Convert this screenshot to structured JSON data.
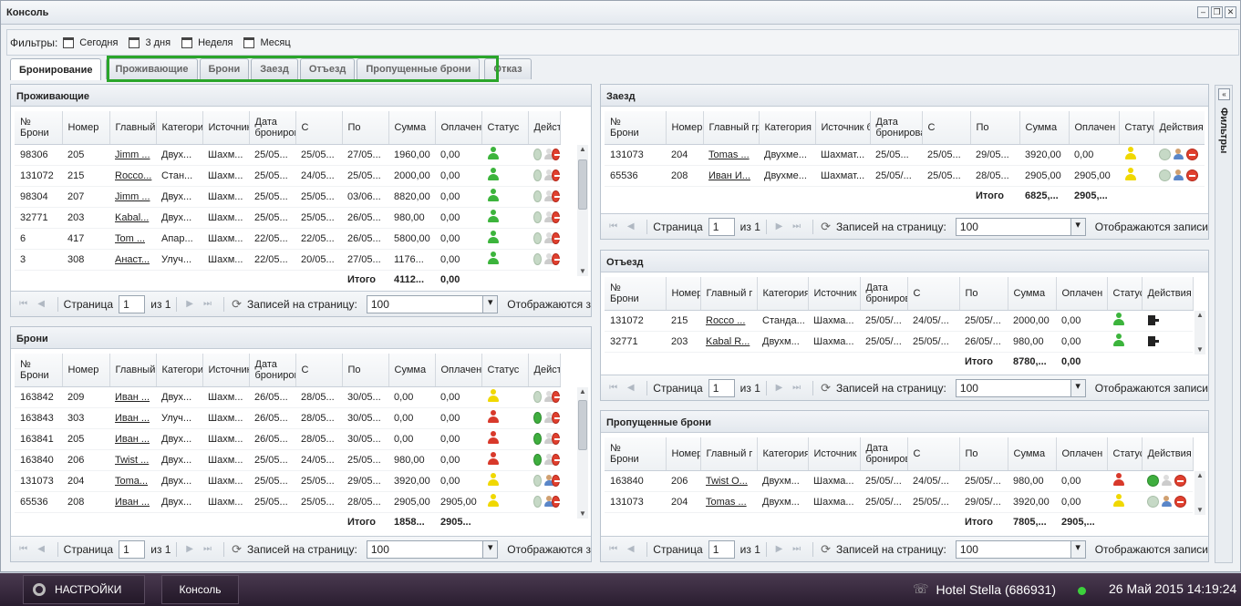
{
  "window": {
    "title": "Консоль"
  },
  "filters": {
    "label": "Фильтры:",
    "items": [
      "Сегодня",
      "3 дня",
      "Неделя",
      "Месяц"
    ]
  },
  "tabs": [
    "Бронирование",
    "Проживающие",
    "Брони",
    "Заезд",
    "Отъезд",
    "Пропущенные брони",
    "Отказ"
  ],
  "pager": {
    "page_label": "Страница",
    "page_value": "1",
    "of_label": "из 1",
    "per_page_label": "Записей на страницу:",
    "per_page_value": "100",
    "showing_label": "Отображаются записи",
    "showing_label_short": "Отображаются з",
    "total_label": "Итого"
  },
  "panels": {
    "residents": {
      "title": "Проживающие",
      "headers": [
        "№\nБрони",
        "Номер",
        "Главный",
        "Категори",
        "Источник",
        "Дата\nброниров",
        "С",
        "По",
        "Сумма",
        "Оплачен",
        "Статус",
        "Действия"
      ],
      "rows": [
        {
          "id": "98306",
          "room": "205",
          "guest": "Jimm ...",
          "cat": "Двух...",
          "src": "Шахм...",
          "date": "25/05...",
          "from": "25/05...",
          "to": "27/05...",
          "sum": "1960,00",
          "paid": "0,00",
          "status": "green",
          "actions": [
            "okg",
            "usrg",
            "no"
          ]
        },
        {
          "id": "131072",
          "room": "215",
          "guest": "Rocco...",
          "cat": "Стан...",
          "src": "Шахм...",
          "date": "25/05...",
          "from": "24/05...",
          "to": "25/05...",
          "sum": "2000,00",
          "paid": "0,00",
          "status": "green",
          "actions": [
            "okg",
            "usrg",
            "no"
          ]
        },
        {
          "id": "98304",
          "room": "207",
          "guest": "Jimm ...",
          "cat": "Двух...",
          "src": "Шахм...",
          "date": "25/05...",
          "from": "25/05...",
          "to": "03/06...",
          "sum": "8820,00",
          "paid": "0,00",
          "status": "green",
          "actions": [
            "okg",
            "usrg",
            "no"
          ]
        },
        {
          "id": "32771",
          "room": "203",
          "guest": "Kabal...",
          "cat": "Двух...",
          "src": "Шахм...",
          "date": "25/05...",
          "from": "25/05...",
          "to": "26/05...",
          "sum": "980,00",
          "paid": "0,00",
          "status": "green",
          "actions": [
            "okg",
            "usrg",
            "no"
          ]
        },
        {
          "id": "6",
          "room": "417",
          "guest": "Tom ...",
          "cat": "Апар...",
          "src": "Шахм...",
          "date": "22/05...",
          "from": "22/05...",
          "to": "26/05...",
          "sum": "5800,00",
          "paid": "0,00",
          "status": "green",
          "actions": [
            "okg",
            "usrg",
            "no"
          ]
        },
        {
          "id": "3",
          "room": "308",
          "guest": "Анаст...",
          "cat": "Улуч...",
          "src": "Шахм...",
          "date": "22/05...",
          "from": "20/05...",
          "to": "27/05...",
          "sum": "1176...",
          "paid": "0,00",
          "status": "green",
          "actions": [
            "okg",
            "usrg",
            "no"
          ]
        }
      ],
      "total_sum": "4112...",
      "total_paid": "0,00"
    },
    "bookings": {
      "title": "Брони",
      "headers": [
        "№\nБрони",
        "Номер",
        "Главный",
        "Категори",
        "Источник",
        "Дата\nброниров",
        "С",
        "По",
        "Сумма",
        "Оплачен",
        "Статус",
        "Действи"
      ],
      "rows": [
        {
          "id": "163842",
          "room": "209",
          "guest": "Иван ...",
          "cat": "Двух...",
          "src": "Шахм...",
          "date": "26/05...",
          "from": "28/05...",
          "to": "30/05...",
          "sum": "0,00",
          "paid": "0,00",
          "status": "yellow",
          "actions": [
            "okg",
            "usrg",
            "no"
          ]
        },
        {
          "id": "163843",
          "room": "303",
          "guest": "Иван ...",
          "cat": "Улуч...",
          "src": "Шахм...",
          "date": "26/05...",
          "from": "28/05...",
          "to": "30/05...",
          "sum": "0,00",
          "paid": "0,00",
          "status": "red",
          "actions": [
            "ok",
            "usrg",
            "no"
          ]
        },
        {
          "id": "163841",
          "room": "205",
          "guest": "Иван ...",
          "cat": "Двух...",
          "src": "Шахм...",
          "date": "26/05...",
          "from": "28/05...",
          "to": "30/05...",
          "sum": "0,00",
          "paid": "0,00",
          "status": "red",
          "actions": [
            "ok",
            "usrg",
            "no"
          ]
        },
        {
          "id": "163840",
          "room": "206",
          "guest": "Twist ...",
          "cat": "Двух...",
          "src": "Шахм...",
          "date": "25/05...",
          "from": "24/05...",
          "to": "25/05...",
          "sum": "980,00",
          "paid": "0,00",
          "status": "red",
          "actions": [
            "ok",
            "usrg",
            "no"
          ]
        },
        {
          "id": "131073",
          "room": "204",
          "guest": "Toma...",
          "cat": "Двух...",
          "src": "Шахм...",
          "date": "25/05...",
          "from": "25/05...",
          "to": "29/05...",
          "sum": "3920,00",
          "paid": "0,00",
          "status": "yellow",
          "actions": [
            "okg",
            "usr",
            "no"
          ]
        },
        {
          "id": "65536",
          "room": "208",
          "guest": "Иван ...",
          "cat": "Двух...",
          "src": "Шахм...",
          "date": "25/05...",
          "from": "25/05...",
          "to": "28/05...",
          "sum": "2905,00",
          "paid": "2905,00",
          "status": "yellow",
          "actions": [
            "okg",
            "usr",
            "no"
          ]
        }
      ],
      "total_sum": "1858...",
      "total_paid": "2905..."
    },
    "checkin": {
      "title": "Заезд",
      "headers": [
        "№\nБрони",
        "Номер",
        "Главный гр",
        "Категория",
        "Источник б",
        "Дата\nбронирова",
        "С",
        "По",
        "Сумма",
        "Оплачен",
        "Статус",
        "Действия"
      ],
      "rows": [
        {
          "id": "131073",
          "room": "204",
          "guest": "Tomas ...",
          "cat": "Двухме...",
          "src": "Шахмат...",
          "date": "25/05...",
          "from": "25/05...",
          "to": "29/05...",
          "sum": "3920,00",
          "paid": "0,00",
          "status": "yellow",
          "actions": [
            "okg",
            "usr",
            "no"
          ]
        },
        {
          "id": "65536",
          "room": "208",
          "guest": "Иван И...",
          "cat": "Двухме...",
          "src": "Шахмат...",
          "date": "25/05/...",
          "from": "25/05...",
          "to": "28/05...",
          "sum": "2905,00",
          "paid": "2905,00",
          "status": "yellow",
          "actions": [
            "okg",
            "usr",
            "no"
          ]
        }
      ],
      "total_sum": "6825,...",
      "total_paid": "2905,..."
    },
    "checkout": {
      "title": "Отъезд",
      "headers": [
        "№\nБрони",
        "Номер",
        "Главный г",
        "Категория",
        "Источник (",
        "Дата\nброниров",
        "С",
        "По",
        "Сумма",
        "Оплачен",
        "Статус",
        "Действия"
      ],
      "rows": [
        {
          "id": "131072",
          "room": "215",
          "guest": "Rocco ...",
          "cat": "Станда...",
          "src": "Шахма...",
          "date": "25/05/...",
          "from": "24/05/...",
          "to": "25/05/...",
          "sum": "2000,00",
          "paid": "0,00",
          "status": "green",
          "actions": [
            "exit"
          ]
        },
        {
          "id": "32771",
          "room": "203",
          "guest": "Kabal R...",
          "cat": "Двухм...",
          "src": "Шахма...",
          "date": "25/05/...",
          "from": "25/05/...",
          "to": "26/05/...",
          "sum": "980,00",
          "paid": "0,00",
          "status": "green",
          "actions": [
            "exit"
          ]
        }
      ],
      "total_sum": "8780,...",
      "total_paid": "0,00"
    },
    "missed": {
      "title": "Пропущенные брони",
      "headers": [
        "№\nБрони",
        "Номер",
        "Главный г",
        "Категория",
        "Источник (",
        "Дата\nброниров",
        "С",
        "По",
        "Сумма",
        "Оплачен",
        "Статус",
        "Действия"
      ],
      "rows": [
        {
          "id": "163840",
          "room": "206",
          "guest": "Twist O...",
          "cat": "Двухм...",
          "src": "Шахма...",
          "date": "25/05/...",
          "from": "24/05/...",
          "to": "25/05/...",
          "sum": "980,00",
          "paid": "0,00",
          "status": "red",
          "actions": [
            "ok",
            "usrg",
            "no"
          ]
        },
        {
          "id": "131073",
          "room": "204",
          "guest": "Tomas ...",
          "cat": "Двухм...",
          "src": "Шахма...",
          "date": "25/05/...",
          "from": "25/05/...",
          "to": "29/05/...",
          "sum": "3920,00",
          "paid": "0,00",
          "status": "yellow",
          "actions": [
            "okg",
            "usr",
            "no"
          ]
        }
      ],
      "total_sum": "7805,...",
      "total_paid": "2905,..."
    }
  },
  "sidebar": {
    "label": "Фильтры"
  },
  "taskbar": {
    "settings": "НАСТРОЙКИ",
    "console": "Консоль",
    "hotel": "Hotel Stella (686931)",
    "datetime": "26 Май 2015 14:19:24"
  },
  "colors": {
    "green": "#3cb43c",
    "yellow": "#f0d800",
    "red": "#d8392b",
    "highlight": "#2aa52a"
  }
}
